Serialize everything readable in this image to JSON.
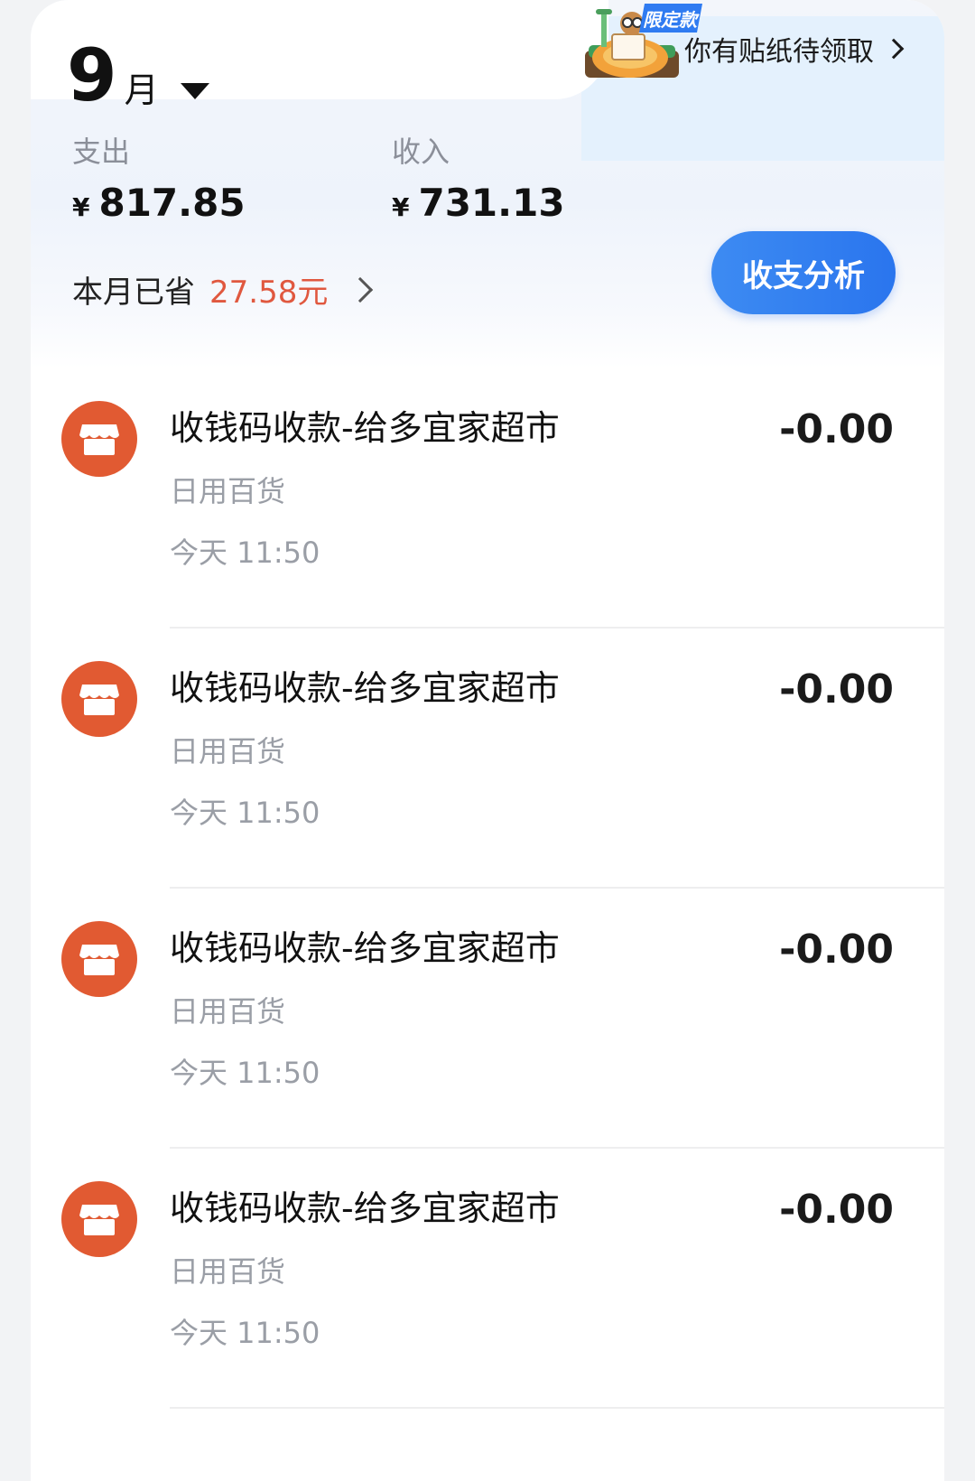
{
  "header": {
    "month_number": "9",
    "month_unit": "月",
    "expense_label": "支出",
    "expense_currency": "¥",
    "expense_amount": "817.85",
    "income_label": "收入",
    "income_currency": "¥",
    "income_amount": "731.13",
    "saved_prefix": "本月已省",
    "saved_amount": "27.58元",
    "analysis_button": "收支分析"
  },
  "banner": {
    "badge": "限定款",
    "text": "你有贴纸待领取"
  },
  "transactions": [
    {
      "title": "收钱码收款-给多宜家超市",
      "category": "日用百货",
      "time": "今天 11:50",
      "amount": "-0.00"
    },
    {
      "title": "收钱码收款-给多宜家超市",
      "category": "日用百货",
      "time": "今天 11:50",
      "amount": "-0.00"
    },
    {
      "title": "收钱码收款-给多宜家超市",
      "category": "日用百货",
      "time": "今天 11:50",
      "amount": "-0.00"
    },
    {
      "title": "收钱码收款-给多宜家超市",
      "category": "日用百货",
      "time": "今天 11:50",
      "amount": "-0.00"
    }
  ],
  "colors": {
    "accent_blue": "#2a75ee",
    "saved_red": "#e0583f",
    "store_icon": "#e15a32"
  },
  "icons": {
    "dropdown": "caret-down-icon",
    "chevron": "chevron-right-icon",
    "store": "store-icon"
  }
}
